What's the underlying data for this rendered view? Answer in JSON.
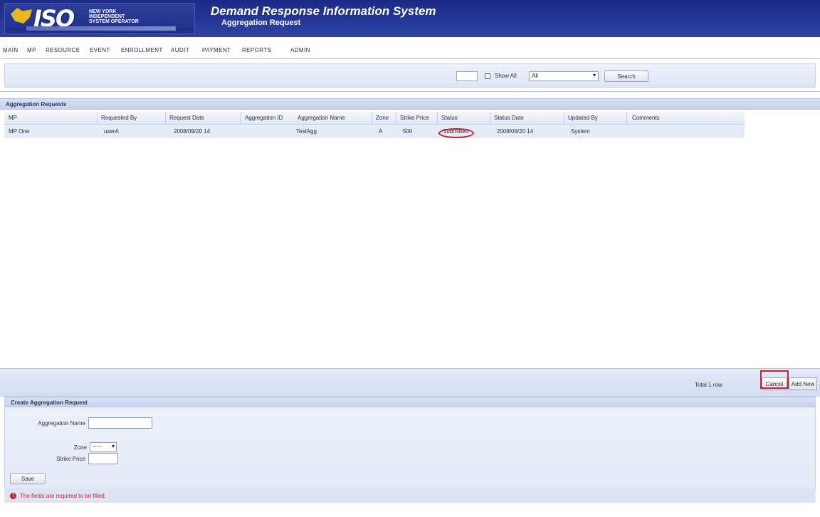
{
  "header": {
    "logo_text": "ISO",
    "logo_words": [
      "NEW YORK",
      "INDEPENDENT",
      "SYSTEM OPERATOR"
    ],
    "title": "Demand Response Information System",
    "subtitle": "Aggregation Request"
  },
  "menu": {
    "items": [
      "MAIN",
      "MP",
      "RESOURCE",
      "EVENT",
      "ENROLLMENT",
      "AUDIT",
      "PAYMENT",
      "REPORTS",
      "ADMIN"
    ]
  },
  "filters": {
    "show_all_label": "Show All",
    "status_value": "All",
    "search_label": "Search"
  },
  "grid": {
    "section_title": "Aggregation Requests",
    "columns": [
      "MP",
      "Requested By",
      "Request Date",
      "Aggregation ID",
      "Aggregation Name",
      "Zone",
      "Strike Price",
      "Status",
      "Status Date",
      "Updated By",
      "Comments"
    ],
    "rows": [
      {
        "mp": "MP One",
        "requested_by": "userA",
        "request_date": "2008/09/20 14",
        "aggregation_id": "",
        "aggregation_name": "TestAgg",
        "zone": "A",
        "strike_price": "500",
        "status": "Submitted",
        "status_date": "2008/09/20 14",
        "updated_by": "System",
        "comments": ""
      }
    ]
  },
  "pager": {
    "text": "Total 1 row",
    "cancel_label": "Cancel",
    "add_label": "Add New"
  },
  "create": {
    "title": "Create Aggregation Request",
    "aggregation_name_label": "Aggregation Name",
    "zone_label": "Zone",
    "zone_value": "-----",
    "strike_price_label": "Strike Price",
    "save_label": "Save",
    "warning": "The fields are required to be filled."
  },
  "colors": {
    "header_blue": "#233494",
    "highlight_red": "#cc1f2f",
    "accent_gold": "#e8b81f"
  }
}
